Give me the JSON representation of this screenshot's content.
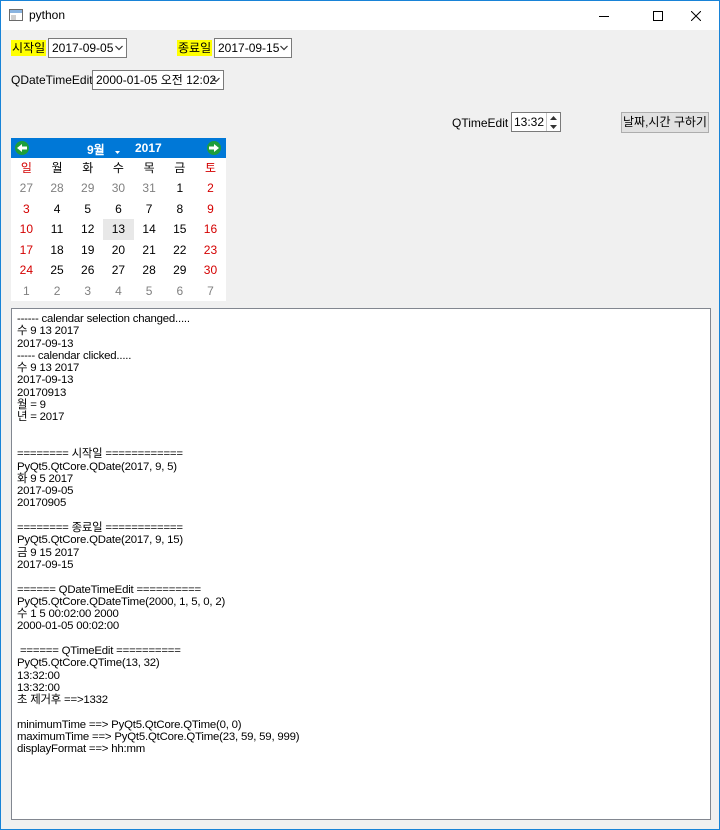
{
  "window": {
    "title": "python"
  },
  "start_date": {
    "label": "시작일",
    "value": "2017-09-05"
  },
  "end_date": {
    "label": "종료일",
    "value": "2017-09-15"
  },
  "datetime_edit": {
    "label": "QDateTimeEdit",
    "value": "2000-01-05 오전 12:02"
  },
  "time_edit": {
    "label": "QTimeEdit",
    "value": "13:32"
  },
  "get_datetime_button": "날짜,시간 구하기",
  "calendar": {
    "month": "9월",
    "year": "2017",
    "weekdays": [
      "일",
      "월",
      "화",
      "수",
      "목",
      "금",
      "토"
    ],
    "rows": [
      [
        "27",
        "28",
        "29",
        "30",
        "31",
        "1",
        "2"
      ],
      [
        "3",
        "4",
        "5",
        "6",
        "7",
        "8",
        "9"
      ],
      [
        "10",
        "11",
        "12",
        "13",
        "14",
        "15",
        "16"
      ],
      [
        "17",
        "18",
        "19",
        "20",
        "21",
        "22",
        "23"
      ],
      [
        "24",
        "25",
        "26",
        "27",
        "28",
        "29",
        "30"
      ],
      [
        "1",
        "2",
        "3",
        "4",
        "5",
        "6",
        "7"
      ]
    ],
    "selected": "13"
  },
  "output_lines": [
    "------ calendar selection changed.....",
    "수 9 13 2017",
    "2017-09-13",
    "----- calendar clicked.....",
    "수 9 13 2017",
    "2017-09-13",
    "20170913",
    "월 = 9",
    "년 = 2017",
    "",
    "",
    "======== 시작일 ============",
    "PyQt5.QtCore.QDate(2017, 9, 5)",
    "화 9 5 2017",
    "2017-09-05",
    "20170905",
    "",
    "======== 종료일 ============",
    "PyQt5.QtCore.QDate(2017, 9, 15)",
    "금 9 15 2017",
    "2017-09-15",
    "",
    "====== QDateTimeEdit ==========",
    "PyQt5.QtCore.QDateTime(2000, 1, 5, 0, 2)",
    "수 1 5 00:02:00 2000",
    "2000-01-05 00:02:00",
    "",
    " ====== QTimeEdit ==========",
    "PyQt5.QtCore.QTime(13, 32)",
    "13:32:00",
    "13:32:00",
    "초 제거후 ==>1332",
    "",
    "minimumTime ==> PyQt5.QtCore.QTime(0, 0)",
    "maximumTime ==> PyQt5.QtCore.QTime(23, 59, 59, 999)",
    "displayFormat ==> hh:mm"
  ]
}
